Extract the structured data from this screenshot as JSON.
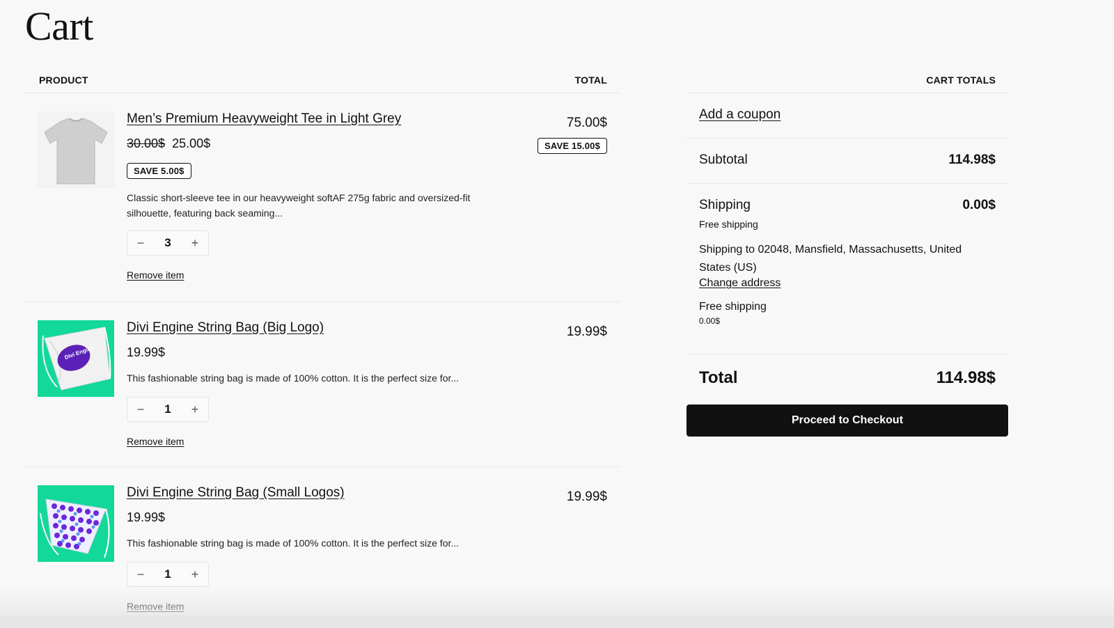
{
  "page": {
    "title": "Cart"
  },
  "table": {
    "product_header": "PRODUCT",
    "total_header": "TOTAL"
  },
  "items": [
    {
      "name": "Men’s Premium Heavyweight Tee in Light Grey",
      "old_price": "30.00$",
      "price": "25.00$",
      "save_badge": "SAVE 5.00$",
      "description": "Classic short-sleeve tee in our heavyweight softAF 275g fabric and oversized-fit silhouette, featuring back seaming...",
      "quantity": "3",
      "remove_label": "Remove item",
      "total": "75.00$",
      "total_save_badge": "SAVE 15.00$",
      "image_icon": "tshirt-image"
    },
    {
      "name": "Divi Engine String Bag (Big Logo)",
      "price": "19.99$",
      "description": "This fashionable string bag is made of 100% cotton. It is the perfect size for...",
      "quantity": "1",
      "remove_label": "Remove item",
      "total": "19.99$",
      "image_icon": "string-bag-big-logo-image",
      "image_logo_text": "Divi Engine"
    },
    {
      "name": "Divi Engine String Bag (Small Logos)",
      "price": "19.99$",
      "description": "This fashionable string bag is made of 100% cotton. It is the perfect size for...",
      "quantity": "1",
      "remove_label": "Remove item",
      "total": "19.99$",
      "image_icon": "string-bag-small-logos-image"
    }
  ],
  "qty_controls": {
    "minus": "−",
    "plus": "+"
  },
  "totals": {
    "header": "CART TOTALS",
    "coupon_label": "Add a coupon",
    "subtotal_label": "Subtotal",
    "subtotal_value": "114.98$",
    "shipping_label": "Shipping",
    "shipping_value": "0.00$",
    "shipping_method": "Free shipping",
    "shipping_to": "Shipping to 02048, Mansfield, Massachusetts, United States (US)",
    "change_address": "Change address",
    "free_shipping_label": "Free shipping",
    "free_shipping_value": "0.00$",
    "total_label": "Total",
    "total_value": "114.98$",
    "checkout_label": "Proceed to Checkout"
  },
  "colors": {
    "accent": "#111111",
    "bag_green": "#12d89a",
    "logo_purple": "#5b21b6"
  }
}
